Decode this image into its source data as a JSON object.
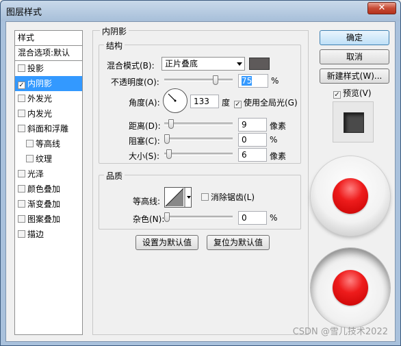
{
  "window": {
    "title": "图层样式",
    "close_label": "✕"
  },
  "stylelist": {
    "header": "样式",
    "blend": "混合选项:默认",
    "items": [
      {
        "label": "投影",
        "checked": false,
        "sub": false,
        "selected": false
      },
      {
        "label": "内阴影",
        "checked": true,
        "sub": false,
        "selected": true
      },
      {
        "label": "外发光",
        "checked": false,
        "sub": false,
        "selected": false
      },
      {
        "label": "内发光",
        "checked": false,
        "sub": false,
        "selected": false
      },
      {
        "label": "斜面和浮雕",
        "checked": false,
        "sub": false,
        "selected": false
      },
      {
        "label": "等高线",
        "checked": false,
        "sub": true,
        "selected": false
      },
      {
        "label": "纹理",
        "checked": false,
        "sub": true,
        "selected": false
      },
      {
        "label": "光泽",
        "checked": false,
        "sub": false,
        "selected": false
      },
      {
        "label": "颜色叠加",
        "checked": false,
        "sub": false,
        "selected": false
      },
      {
        "label": "渐变叠加",
        "checked": false,
        "sub": false,
        "selected": false
      },
      {
        "label": "图案叠加",
        "checked": false,
        "sub": false,
        "selected": false
      },
      {
        "label": "描边",
        "checked": false,
        "sub": false,
        "selected": false
      }
    ]
  },
  "inner_shadow": {
    "title": "内阴影",
    "structure_title": "结构",
    "blend_mode_label": "混合模式(B):",
    "blend_mode_value": "正片叠底",
    "shadow_color": "#5e5a5a",
    "opacity_label": "不透明度(O):",
    "opacity_value": "75",
    "opacity_unit": "%",
    "angle_label": "角度(A):",
    "angle_value": "133",
    "angle_unit": "度",
    "global_light_label": "使用全局光(G)",
    "global_light_checked": true,
    "distance_label": "距离(D):",
    "distance_value": "9",
    "distance_unit": "像素",
    "choke_label": "阻塞(C):",
    "choke_value": "0",
    "choke_unit": "%",
    "size_label": "大小(S):",
    "size_value": "6",
    "size_unit": "像素",
    "quality_title": "品质",
    "contour_label": "等高线:",
    "antialias_label": "消除锯齿(L)",
    "antialias_checked": false,
    "noise_label": "杂色(N):",
    "noise_value": "0",
    "noise_unit": "%",
    "set_default_label": "设置为默认值",
    "reset_default_label": "复位为默认值"
  },
  "actions": {
    "ok_label": "确定",
    "cancel_label": "取消",
    "new_style_label": "新建样式(W)...",
    "preview_label": "预览(V)",
    "preview_checked": true
  },
  "watermark": "CSDN @雪儿技术2022"
}
